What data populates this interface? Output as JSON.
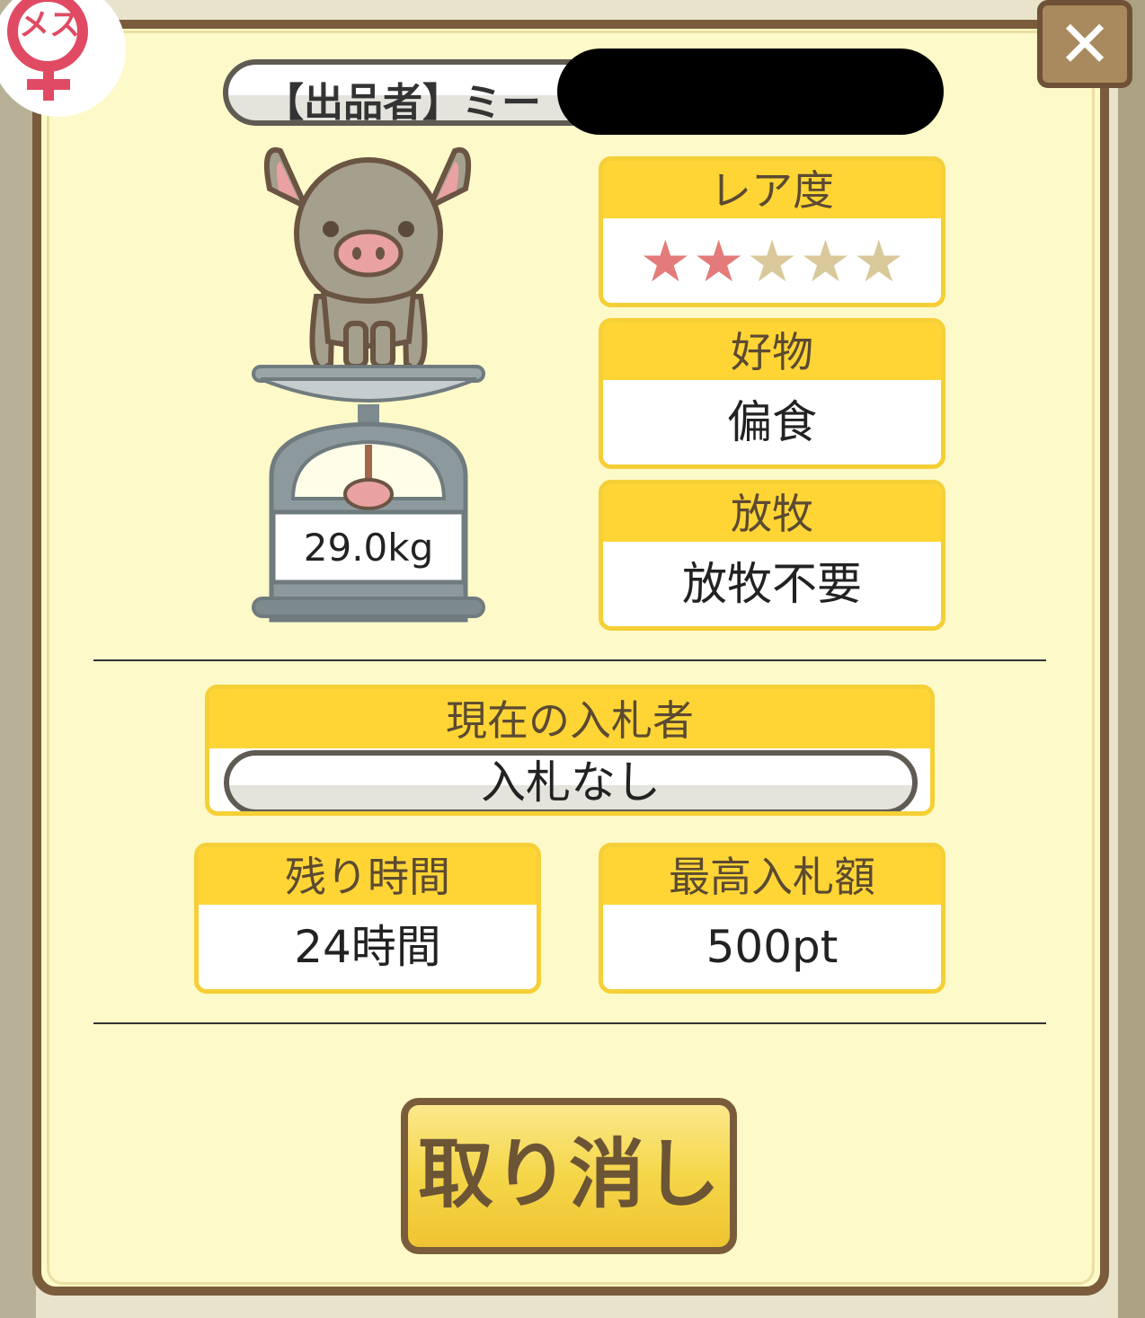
{
  "badge": {
    "sex_label": "メス"
  },
  "close": {
    "glyph": "✕"
  },
  "seller": {
    "label": "【出品者】ミー"
  },
  "pig": {
    "weight": "29.0kg"
  },
  "rarity": {
    "title": "レア度",
    "rating": 2,
    "max": 5
  },
  "favorite": {
    "title": "好物",
    "value": "偏食"
  },
  "grazing": {
    "title": "放牧",
    "value": "放牧不要"
  },
  "bidder": {
    "title": "現在の入札者",
    "value": "入札なし"
  },
  "remaining": {
    "title": "残り時間",
    "value": "24時間"
  },
  "highest_bid": {
    "title": "最高入札額",
    "value": "500pt"
  },
  "actions": {
    "cancel_label": "取り消し"
  },
  "colors": {
    "accent": "#ffd535",
    "frame": "#7a5c3c",
    "panel": "#fef9c8",
    "star_on": "#e47b7b",
    "star_off": "#d9c89a"
  }
}
